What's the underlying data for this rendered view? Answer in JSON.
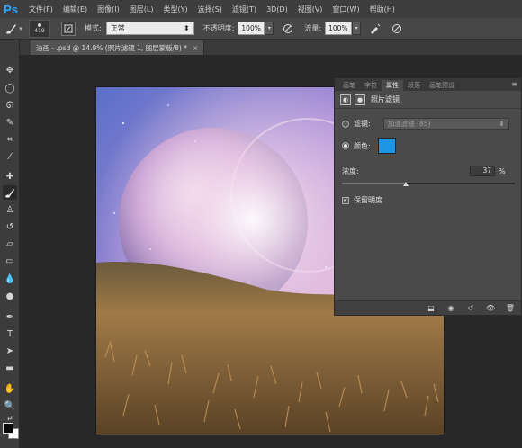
{
  "app": {
    "logo": "Ps",
    "menu": [
      "文件(F)",
      "编辑(E)",
      "图像(I)",
      "图层(L)",
      "类型(Y)",
      "选择(S)",
      "滤镜(T)",
      "3D(D)",
      "视图(V)",
      "窗口(W)",
      "帮助(H)"
    ]
  },
  "options": {
    "brush_size": "419",
    "mode_label": "模式:",
    "mode_value": "正常",
    "opacity_label": "不透明度:",
    "opacity_value": "100%",
    "flow_label": "流量:",
    "flow_value": "100%"
  },
  "document": {
    "tab_title": "油画 - .psd @ 14.9% (照片滤镜 1, 图层蒙版/8) *",
    "close": "×"
  },
  "panel": {
    "tabs": [
      "画笔",
      "字符",
      "属性",
      "段落",
      "画笔预设"
    ],
    "active_tab": 2,
    "title": "照片滤镜",
    "filter_label": "滤镜:",
    "filter_value": "加温滤镜 (85)",
    "filter_selected": false,
    "color_label": "颜色:",
    "color_selected": true,
    "color_value": "#1e96e6",
    "density_label": "浓度:",
    "density_value": "37",
    "density_unit": "%",
    "density_fraction": 0.37,
    "preserve_label": "保留明度",
    "preserve_checked": true
  },
  "colors": {
    "foreground": "#0a0a0a",
    "background": "#ffffff",
    "accent": "#31a8ff"
  }
}
